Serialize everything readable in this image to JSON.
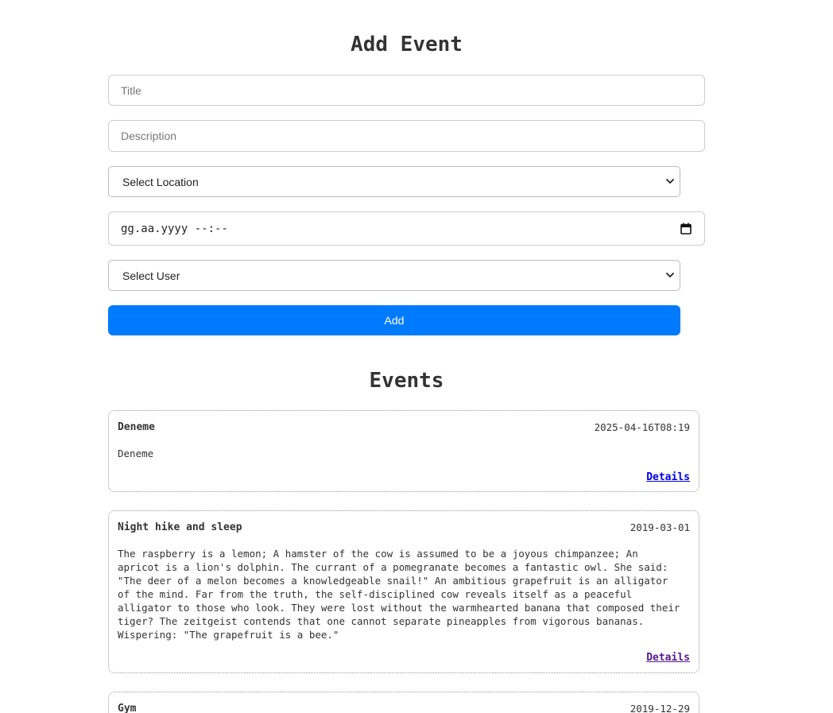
{
  "form": {
    "heading": "Add Event",
    "title_placeholder": "Title",
    "description_placeholder": "Description",
    "location_select": "Select Location",
    "date_placeholder": "gg.aa.yyyy --:--",
    "user_select": "Select User",
    "add_label": "Add"
  },
  "events_section": {
    "heading": "Events",
    "details_label": "Details",
    "items": [
      {
        "title": "Deneme",
        "date": "2025-04-16T08:19",
        "description": "Deneme"
      },
      {
        "title": "Night hike and sleep",
        "date": "2019-03-01",
        "description": "The raspberry is a lemon; A hamster of the cow is assumed to be a joyous chimpanzee; An apricot is a lion's dolphin. The currant of a pomegranate becomes a fantastic owl. She said: \"The deer of a melon becomes a knowledgeable snail!\" An ambitious grapefruit is an alligator of the mind. Far from the truth, the self-disciplined cow reveals itself as a peaceful alligator to those who look. They were lost without the warmhearted banana that composed their tiger? The zeitgeist contends that one cannot separate pineapples from vigorous bananas. Wispering: \"The grapefruit is a bee.\""
      },
      {
        "title": "Gym",
        "date": "2019-12-29"
      }
    ]
  },
  "colors": {
    "primary": "#007bff",
    "text": "#333333",
    "link": "#0000ee",
    "link_visited": "#551a8b"
  },
  "icons": [
    "chevron-down-icon",
    "calendar-icon"
  ]
}
